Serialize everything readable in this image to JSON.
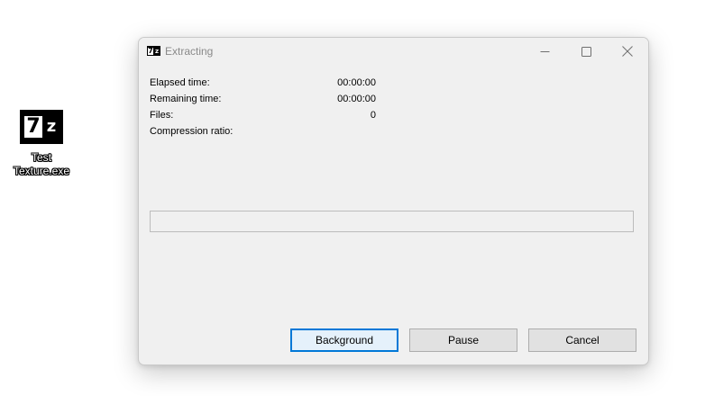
{
  "desktop": {
    "icon": {
      "name": "7z-app-icon",
      "logo_glyph_1": "7",
      "logo_glyph_2": "z",
      "label_line1": "Test",
      "label_line2": "Texture.exe"
    }
  },
  "window": {
    "title": "Extracting",
    "title_icon": "7z-icon",
    "controls": {
      "minimize": "minimize-icon",
      "maximize": "maximize-icon",
      "close": "close-icon"
    },
    "info": {
      "elapsed_label": "Elapsed time:",
      "elapsed_value": "00:00:00",
      "remaining_label": "Remaining time:",
      "remaining_value": "00:00:00",
      "files_label": "Files:",
      "files_value": "0",
      "compression_label": "Compression ratio:",
      "compression_value": ""
    },
    "progress": {
      "fraction": 0
    },
    "buttons": {
      "background_label": "Background",
      "pause_label": "Pause",
      "cancel_label": "Cancel"
    }
  },
  "colors": {
    "window_bg": "#f0f0f0",
    "default_button_border": "#0078d7",
    "progress_fill": "#06b025"
  }
}
